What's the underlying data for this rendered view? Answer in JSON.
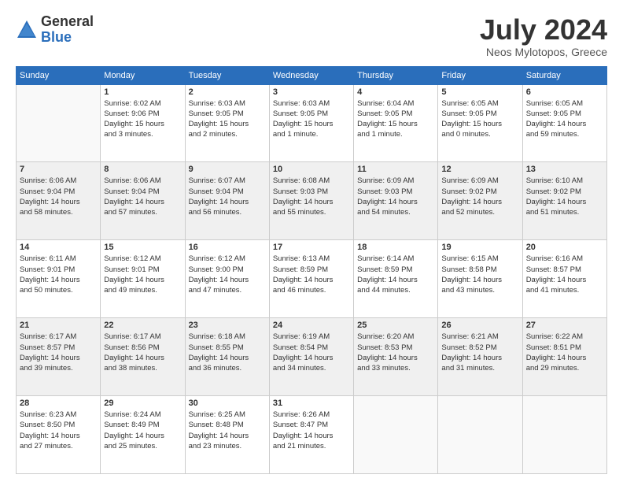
{
  "logo": {
    "general": "General",
    "blue": "Blue"
  },
  "title": "July 2024",
  "location": "Neos Mylotopos, Greece",
  "headers": [
    "Sunday",
    "Monday",
    "Tuesday",
    "Wednesday",
    "Thursday",
    "Friday",
    "Saturday"
  ],
  "weeks": [
    [
      {
        "day": "",
        "info": ""
      },
      {
        "day": "1",
        "info": "Sunrise: 6:02 AM\nSunset: 9:06 PM\nDaylight: 15 hours\nand 3 minutes."
      },
      {
        "day": "2",
        "info": "Sunrise: 6:03 AM\nSunset: 9:05 PM\nDaylight: 15 hours\nand 2 minutes."
      },
      {
        "day": "3",
        "info": "Sunrise: 6:03 AM\nSunset: 9:05 PM\nDaylight: 15 hours\nand 1 minute."
      },
      {
        "day": "4",
        "info": "Sunrise: 6:04 AM\nSunset: 9:05 PM\nDaylight: 15 hours\nand 1 minute."
      },
      {
        "day": "5",
        "info": "Sunrise: 6:05 AM\nSunset: 9:05 PM\nDaylight: 15 hours\nand 0 minutes."
      },
      {
        "day": "6",
        "info": "Sunrise: 6:05 AM\nSunset: 9:05 PM\nDaylight: 14 hours\nand 59 minutes."
      }
    ],
    [
      {
        "day": "7",
        "info": "Sunrise: 6:06 AM\nSunset: 9:04 PM\nDaylight: 14 hours\nand 58 minutes."
      },
      {
        "day": "8",
        "info": "Sunrise: 6:06 AM\nSunset: 9:04 PM\nDaylight: 14 hours\nand 57 minutes."
      },
      {
        "day": "9",
        "info": "Sunrise: 6:07 AM\nSunset: 9:04 PM\nDaylight: 14 hours\nand 56 minutes."
      },
      {
        "day": "10",
        "info": "Sunrise: 6:08 AM\nSunset: 9:03 PM\nDaylight: 14 hours\nand 55 minutes."
      },
      {
        "day": "11",
        "info": "Sunrise: 6:09 AM\nSunset: 9:03 PM\nDaylight: 14 hours\nand 54 minutes."
      },
      {
        "day": "12",
        "info": "Sunrise: 6:09 AM\nSunset: 9:02 PM\nDaylight: 14 hours\nand 52 minutes."
      },
      {
        "day": "13",
        "info": "Sunrise: 6:10 AM\nSunset: 9:02 PM\nDaylight: 14 hours\nand 51 minutes."
      }
    ],
    [
      {
        "day": "14",
        "info": "Sunrise: 6:11 AM\nSunset: 9:01 PM\nDaylight: 14 hours\nand 50 minutes."
      },
      {
        "day": "15",
        "info": "Sunrise: 6:12 AM\nSunset: 9:01 PM\nDaylight: 14 hours\nand 49 minutes."
      },
      {
        "day": "16",
        "info": "Sunrise: 6:12 AM\nSunset: 9:00 PM\nDaylight: 14 hours\nand 47 minutes."
      },
      {
        "day": "17",
        "info": "Sunrise: 6:13 AM\nSunset: 8:59 PM\nDaylight: 14 hours\nand 46 minutes."
      },
      {
        "day": "18",
        "info": "Sunrise: 6:14 AM\nSunset: 8:59 PM\nDaylight: 14 hours\nand 44 minutes."
      },
      {
        "day": "19",
        "info": "Sunrise: 6:15 AM\nSunset: 8:58 PM\nDaylight: 14 hours\nand 43 minutes."
      },
      {
        "day": "20",
        "info": "Sunrise: 6:16 AM\nSunset: 8:57 PM\nDaylight: 14 hours\nand 41 minutes."
      }
    ],
    [
      {
        "day": "21",
        "info": "Sunrise: 6:17 AM\nSunset: 8:57 PM\nDaylight: 14 hours\nand 39 minutes."
      },
      {
        "day": "22",
        "info": "Sunrise: 6:17 AM\nSunset: 8:56 PM\nDaylight: 14 hours\nand 38 minutes."
      },
      {
        "day": "23",
        "info": "Sunrise: 6:18 AM\nSunset: 8:55 PM\nDaylight: 14 hours\nand 36 minutes."
      },
      {
        "day": "24",
        "info": "Sunrise: 6:19 AM\nSunset: 8:54 PM\nDaylight: 14 hours\nand 34 minutes."
      },
      {
        "day": "25",
        "info": "Sunrise: 6:20 AM\nSunset: 8:53 PM\nDaylight: 14 hours\nand 33 minutes."
      },
      {
        "day": "26",
        "info": "Sunrise: 6:21 AM\nSunset: 8:52 PM\nDaylight: 14 hours\nand 31 minutes."
      },
      {
        "day": "27",
        "info": "Sunrise: 6:22 AM\nSunset: 8:51 PM\nDaylight: 14 hours\nand 29 minutes."
      }
    ],
    [
      {
        "day": "28",
        "info": "Sunrise: 6:23 AM\nSunset: 8:50 PM\nDaylight: 14 hours\nand 27 minutes."
      },
      {
        "day": "29",
        "info": "Sunrise: 6:24 AM\nSunset: 8:49 PM\nDaylight: 14 hours\nand 25 minutes."
      },
      {
        "day": "30",
        "info": "Sunrise: 6:25 AM\nSunset: 8:48 PM\nDaylight: 14 hours\nand 23 minutes."
      },
      {
        "day": "31",
        "info": "Sunrise: 6:26 AM\nSunset: 8:47 PM\nDaylight: 14 hours\nand 21 minutes."
      },
      {
        "day": "",
        "info": ""
      },
      {
        "day": "",
        "info": ""
      },
      {
        "day": "",
        "info": ""
      }
    ]
  ]
}
